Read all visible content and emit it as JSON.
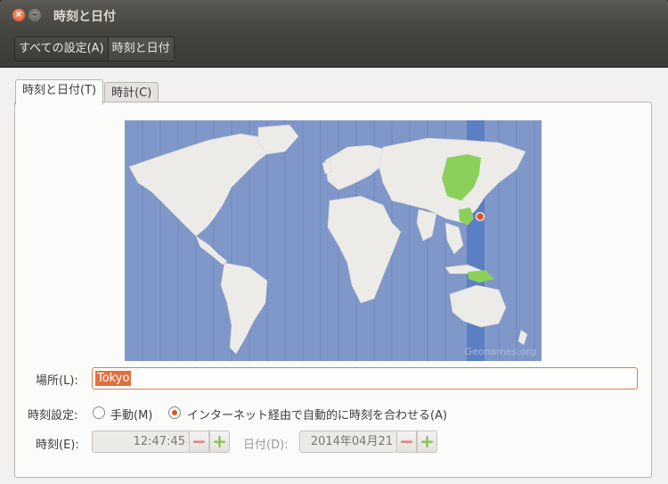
{
  "window": {
    "title": "時刻と日付",
    "close_glyph": "×",
    "minimize_glyph": "–"
  },
  "breadcrumb": {
    "all_settings": "すべての設定(A)",
    "current": "時刻と日付"
  },
  "tabs": [
    {
      "label": "時刻と日付(T)"
    },
    {
      "label": "時計(C)"
    }
  ],
  "map": {
    "credit": "Geonames.org",
    "colors": {
      "ocean": "#7f98c9",
      "land": "#edebe8",
      "timezone_band": "#5b7fc4",
      "selected_zone": "#8bd05a",
      "marker": "#e0532a"
    }
  },
  "location": {
    "label": "場所(L):",
    "value": "Tokyo"
  },
  "time_setting": {
    "label": "時刻設定:",
    "manual_label": "手動(M)",
    "auto_label": "インターネット経由で自動的に時刻を合わせる(A)",
    "selected": "auto"
  },
  "time": {
    "label": "時刻(E):",
    "value": "12:47:45"
  },
  "date": {
    "label": "日付(D):",
    "value": "2014年04月21"
  },
  "spin_glyphs": {
    "minus": "−",
    "plus": "+"
  }
}
